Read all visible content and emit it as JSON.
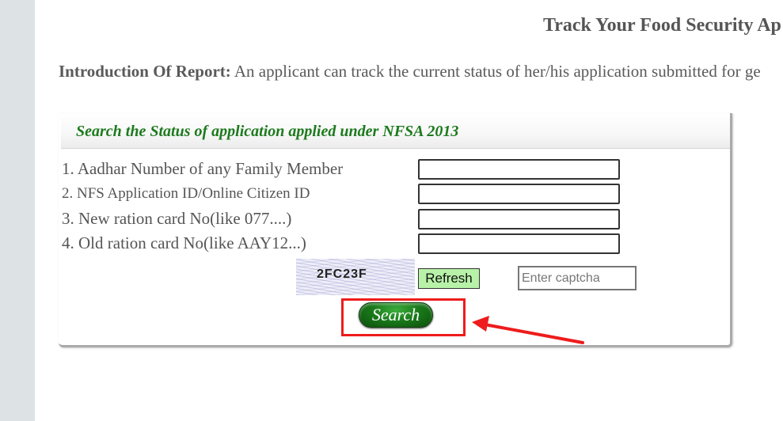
{
  "page": {
    "title": "Track Your Food Security Ap",
    "intro_label": "Introduction Of Report:",
    "intro_text": " An applicant can track the current status of her/his application submitted for ge"
  },
  "panel": {
    "title": "Search the Status of application applied under NFSA 2013"
  },
  "fields": [
    {
      "label": "1.  Aadhar Number of any Family Member",
      "value": ""
    },
    {
      "label": "2.  NFS Application ID/Online Citizen ID",
      "value": ""
    },
    {
      "label": "3.  New ration card No(like 077....)",
      "value": ""
    },
    {
      "label": "4.  Old ration card No(like AAY12...)",
      "value": ""
    }
  ],
  "captcha": {
    "code": "2FC23F",
    "refresh_label": "Refresh",
    "input_placeholder": "Enter captcha",
    "input_value": ""
  },
  "search_button": {
    "label": "Search"
  },
  "colors": {
    "panel_title": "#1d7a1d",
    "highlight": "#ee1c1c",
    "refresh_bg": "#b8f2a8",
    "search_bg": "#1a7a1a"
  }
}
